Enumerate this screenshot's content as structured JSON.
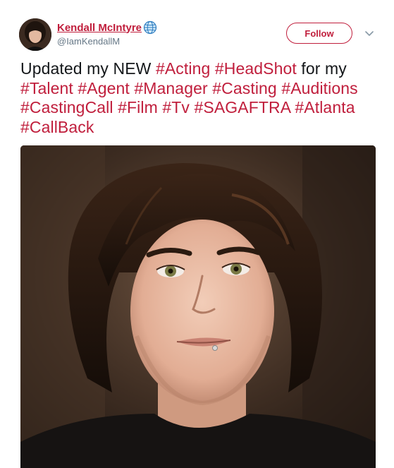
{
  "user": {
    "display_name": "Kendall McIntyre",
    "handle": "@IamKendallM",
    "verified_icon": "globe-icon"
  },
  "actions": {
    "follow_label": "Follow",
    "menu_icon": "chevron-down-icon"
  },
  "tweet": {
    "segments": [
      {
        "text": "Updated my NEW ",
        "type": "text"
      },
      {
        "text": "#Acting",
        "type": "hashtag"
      },
      {
        "text": " ",
        "type": "text"
      },
      {
        "text": "#HeadShot",
        "type": "hashtag"
      },
      {
        "text": " for my ",
        "type": "text"
      },
      {
        "text": "#Talent",
        "type": "hashtag"
      },
      {
        "text": " ",
        "type": "text"
      },
      {
        "text": "#Agent",
        "type": "hashtag"
      },
      {
        "text": " ",
        "type": "text"
      },
      {
        "text": "#Manager",
        "type": "hashtag"
      },
      {
        "text": " ",
        "type": "text"
      },
      {
        "text": "#Casting",
        "type": "hashtag"
      },
      {
        "text": " ",
        "type": "text"
      },
      {
        "text": "#Auditions",
        "type": "hashtag"
      },
      {
        "text": " ",
        "type": "text"
      },
      {
        "text": "#CastingCall",
        "type": "hashtag"
      },
      {
        "text": " ",
        "type": "text"
      },
      {
        "text": "#Film",
        "type": "hashtag"
      },
      {
        "text": " ",
        "type": "text"
      },
      {
        "text": "#Tv",
        "type": "hashtag"
      },
      {
        "text": " ",
        "type": "text"
      },
      {
        "text": "#SAGAFTRA",
        "type": "hashtag"
      },
      {
        "text": " ",
        "type": "text"
      },
      {
        "text": "#Atlanta",
        "type": "hashtag"
      },
      {
        "text": " ",
        "type": "text"
      },
      {
        "text": "#CallBack",
        "type": "hashtag"
      }
    ]
  },
  "colors": {
    "accent": "#c01e3c",
    "text": "#14171a",
    "secondary": "#657786"
  }
}
